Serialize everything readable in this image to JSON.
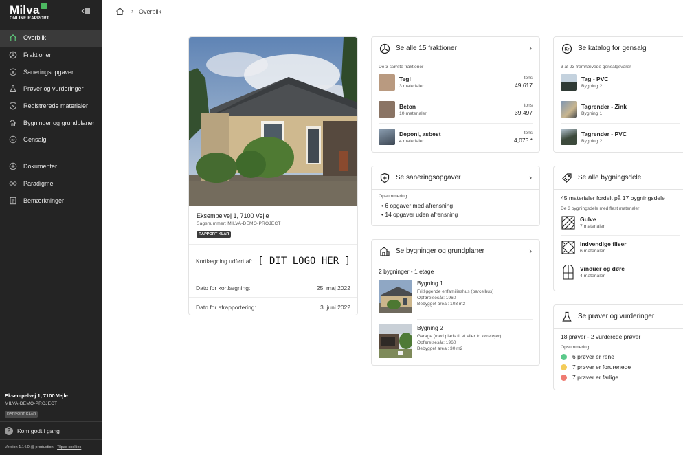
{
  "brand": {
    "name": "Milva",
    "sub": "ONLINE RAPPORT"
  },
  "nav": {
    "items": [
      {
        "label": "Overblik"
      },
      {
        "label": "Fraktioner"
      },
      {
        "label": "Saneringsopgaver"
      },
      {
        "label": "Prøver og vurderinger"
      },
      {
        "label": "Registrerede materialer"
      },
      {
        "label": "Bygninger og grundplaner"
      },
      {
        "label": "Gensalg"
      },
      {
        "label": "Dokumenter"
      },
      {
        "label": "Paradigme"
      },
      {
        "label": "Bemærkninger"
      }
    ]
  },
  "sidebar_footer": {
    "address": "Eksempelvej 1, 7100 Vejle",
    "case": "MILVA-DEMO-PROJECT",
    "badge": "RAPPORT KLAR",
    "help": "Kom godt i gang",
    "version": "Version 1.14.0 @ production - ",
    "cookies": "Tilpas cookies"
  },
  "breadcrumb": {
    "current": "Overblik"
  },
  "project": {
    "address": "Eksempelvej 1, 7100 Vejle",
    "case_label": "Sagsnummer: MILVA-DEMO-PROJECT",
    "badge": "RAPPORT KLAR",
    "mapped_by_label": "Kortlægning udført af:",
    "logo_placeholder": "[ DIT LOGO HER ]",
    "date_mapping_label": "Dato for kortlægning:",
    "date_mapping": "25. maj 2022",
    "date_report_label": "Dato for afrapportering:",
    "date_report": "3. juni 2022"
  },
  "fractions": {
    "title": "Se alle 15 fraktioner",
    "subtitle": "De 3 største fraktioner",
    "items": [
      {
        "name": "Tegl",
        "count": "3 materialer",
        "unit": "tons",
        "value": "49,617",
        "color": "#b99a80"
      },
      {
        "name": "Beton",
        "count": "10 materialer",
        "unit": "tons",
        "value": "39,497",
        "color": "#8a7464"
      },
      {
        "name": "Deponi, asbest",
        "count": "4 materialer",
        "unit": "tons",
        "value": "4,073 *",
        "color": "#4d5864"
      }
    ]
  },
  "remediation": {
    "title": "Se saneringsopgaver",
    "subtitle": "Opsummering",
    "bullets": [
      "6 opgaver med afrensning",
      "14 opgaver uden afrensning"
    ]
  },
  "buildings": {
    "title": "Se bygninger og grundplaner",
    "summary": "2 bygninger - 1 etage",
    "items": [
      {
        "name": "Bygning 1",
        "type": "Fritliggende enfamilieshus (parcelhus)",
        "year": "Opførelsesår: 1960",
        "area": "Bebygget areal: 103 m2"
      },
      {
        "name": "Bygning 2",
        "type": "Garage (med plads til et eller to køretøjer)",
        "year": "Opførelsesår: 1960",
        "area": "Bebygget areal: 30 m2"
      }
    ]
  },
  "resale": {
    "title": "Se katalog for gensalg",
    "subtitle": "3 af 23 fremhævede gensalgsvarer",
    "items": [
      {
        "name": "Tag - PVC",
        "building": "Bygning 2"
      },
      {
        "name": "Tagrender - Zink",
        "building": "Bygning 1"
      },
      {
        "name": "Tagrender - PVC",
        "building": "Bygning 2"
      }
    ]
  },
  "building_parts": {
    "title": "Se alle bygningsdele",
    "summary": "45 materialer fordelt på 17 bygningsdele",
    "subtitle": "De 3 bygningsdele med flest materialer",
    "items": [
      {
        "name": "Gulve",
        "count": "7 materialer"
      },
      {
        "name": "Indvendige fliser",
        "count": "6 materialer"
      },
      {
        "name": "Vinduer og døre",
        "count": "4 materialer"
      }
    ]
  },
  "samples": {
    "title": "Se prøver og vurderinger",
    "summary": "18 prøver - 2 vurderede prøver",
    "subtitle": "Opsummering",
    "items": [
      {
        "label": "6 prøver er rene",
        "color": "#5bc98a"
      },
      {
        "label": "7 prøver er forurenede",
        "color": "#f3cc5a"
      },
      {
        "label": "7 prøver er farlige",
        "color": "#ef7b72"
      }
    ]
  }
}
